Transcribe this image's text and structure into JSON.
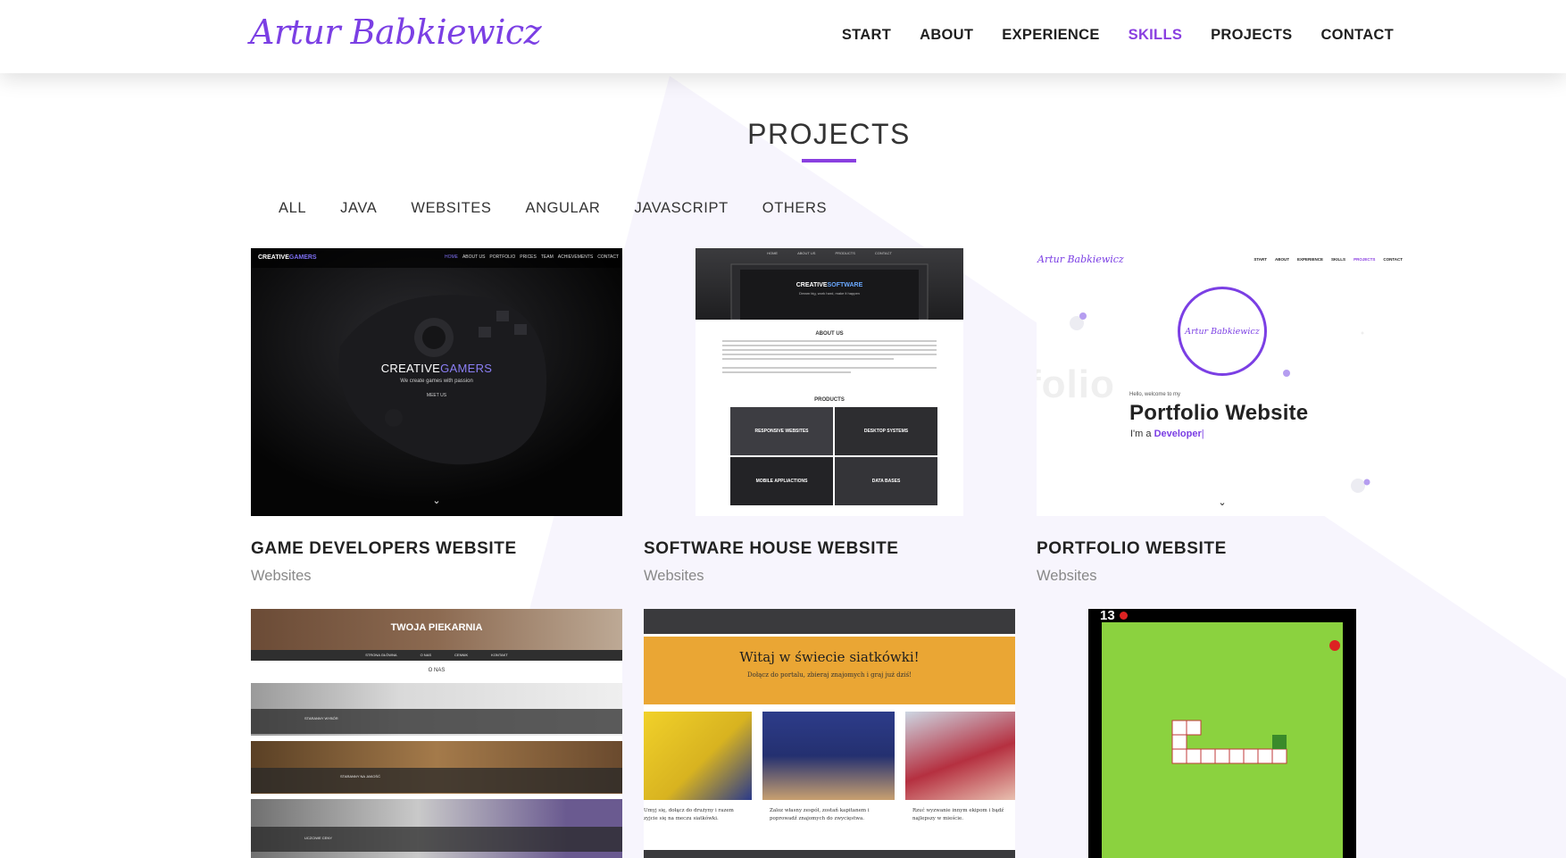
{
  "header": {
    "logo": "Artur Babkiewicz",
    "nav": [
      "START",
      "ABOUT",
      "EXPERIENCE",
      "SKILLS",
      "PROJECTS",
      "CONTACT"
    ],
    "active": "SKILLS"
  },
  "section": {
    "title": "PROJECTS",
    "filters": [
      "ALL",
      "JAVA",
      "WEBSITES",
      "ANGULAR",
      "JAVASCRIPT",
      "OTHERS"
    ]
  },
  "projects": [
    {
      "title": "GAME DEVELOPERS WEBSITE",
      "category": "Websites",
      "preview": {
        "brand_a": "CREATIVE",
        "brand_b": "GAMERS",
        "nav": [
          "HOME",
          "ABOUT US",
          "PORTFOLIO",
          "PRICES",
          "TEAM",
          "ACHIEVEMENTS",
          "CONTACT"
        ],
        "tagline": "We create games with passion",
        "button": "MEET US"
      }
    },
    {
      "title": "SOFTWARE HOUSE WEBSITE",
      "category": "Websites",
      "preview": {
        "nav": [
          "HOME",
          "ABOUT US",
          "PRODUCTS",
          "CONTACT"
        ],
        "brand_a": "CREATIVE",
        "brand_b": "SOFTWARE",
        "tagline": "Dream big, work hard, make it happen",
        "about": "ABOUT US",
        "products": "PRODUCTS",
        "tiles": [
          "RESPONSIVE WEBSITES",
          "DESKTOP SYSTEMS",
          "MOBILE APPLIACTIONS",
          "DATA BASES"
        ]
      }
    },
    {
      "title": "PORTFOLIO WEBSITE",
      "category": "Websites",
      "preview": {
        "logo": "Artur Babkiewicz",
        "nav": [
          "START",
          "ABOUT",
          "EXPERIENCE",
          "SKILLS",
          "PROJECTS",
          "CONTACT"
        ],
        "circle_name": "Artur Babkiewicz",
        "hello": "Hello, welcome to my",
        "heading": "Portfolio Website",
        "im_a": "I'm a",
        "role": "Developer",
        "bg_word": "folio"
      }
    },
    {
      "preview": {
        "title": "TWOJA PIEKARNIA",
        "nav": [
          "STRONA GŁÓWNA",
          "O NAS",
          "CENNIK",
          "KONTAKT"
        ],
        "about": "O NAS",
        "rows": [
          "STARANNY WYBÓR",
          "STARANNY NA JAKOŚĆ",
          "UCZCIWE CENY"
        ]
      }
    },
    {
      "preview": {
        "heading": "Witaj w świecie siatkówki!",
        "sub": "Dołącz do portalu, zbieraj znajomych i graj już dziś!",
        "captions": [
          "Umyj się, dołącz do drużyny i razem zyjcie się na meczu siatkówki.",
          "Zaloz własny zespół, zostań kapitanem i poprowadź znajomych do zwycięstwa.",
          "Rzuć wyzwanie innym ekipom i bądź najlepszy w mieście."
        ]
      }
    },
    {
      "preview": {
        "score": "13"
      }
    }
  ],
  "colors": {
    "accent": "#8a3fe0",
    "text": "#222222",
    "muted": "#888888"
  }
}
